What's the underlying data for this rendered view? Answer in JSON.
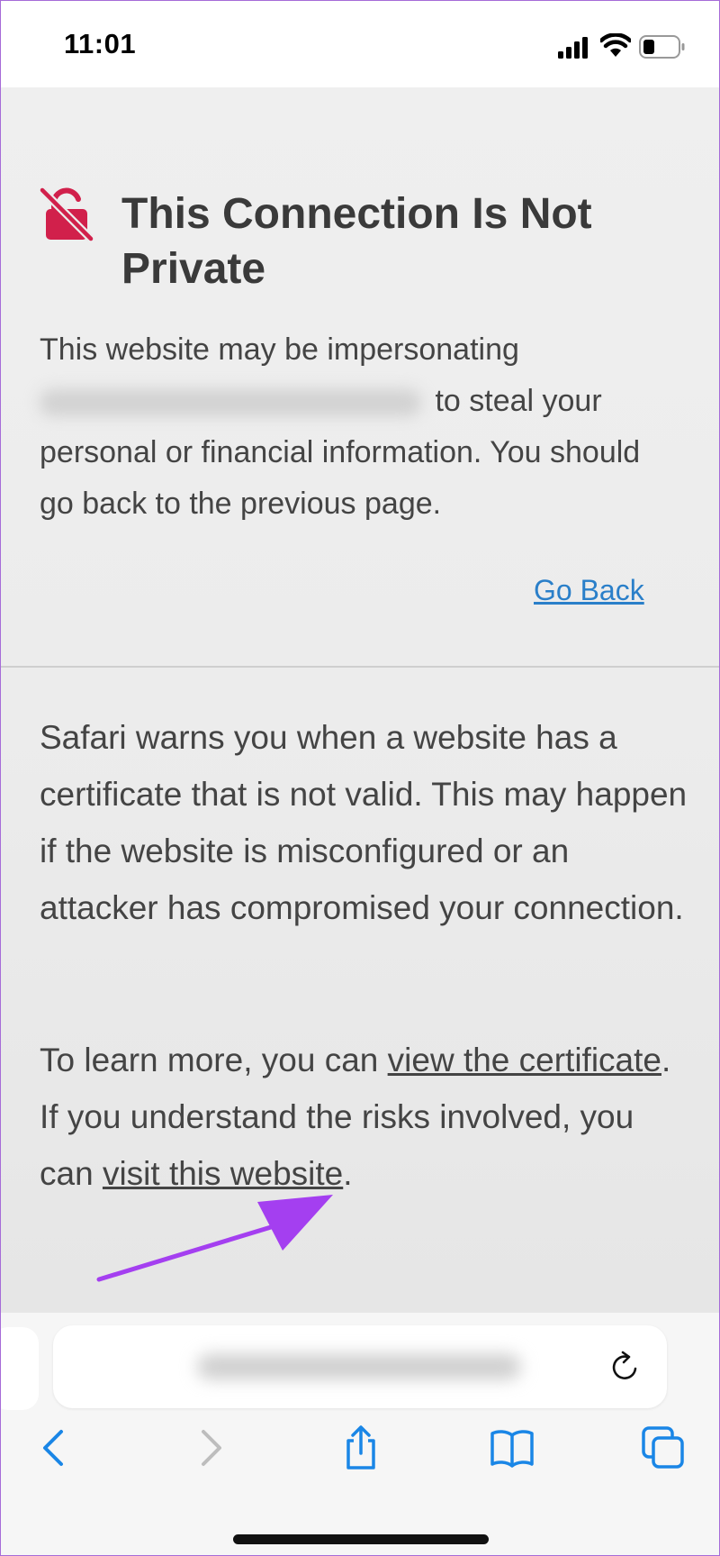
{
  "status_bar": {
    "time": "11:01",
    "icons": [
      "cellular-signal-icon",
      "wifi-icon",
      "battery-icon"
    ]
  },
  "warning": {
    "title": "This Connection Is Not Private",
    "intro_before": "This website may be impersonating",
    "intro_after": "to steal your personal or financial information. You should go back to the previous page.",
    "go_back_label": "Go Back",
    "explanation": "Safari warns you when a website has a certificate that is not valid. This may happen if the website is misconfigured or an attacker has compromised your connection.",
    "learn_more_prefix": "To learn more, you can ",
    "view_certificate_label": "view the certificate",
    "learn_more_middle": ". If you understand the risks involved, you can ",
    "visit_website_label": "visit this website",
    "learn_more_suffix": "."
  },
  "toolbar": {
    "items": [
      "back-icon",
      "forward-icon",
      "share-icon",
      "bookmarks-icon",
      "tabs-icon"
    ]
  },
  "colors": {
    "link_blue": "#2a7fc9",
    "warning_red": "#d1204b",
    "arrow_purple": "#a43ff0",
    "toolbar_blue": "#1a86e6"
  }
}
